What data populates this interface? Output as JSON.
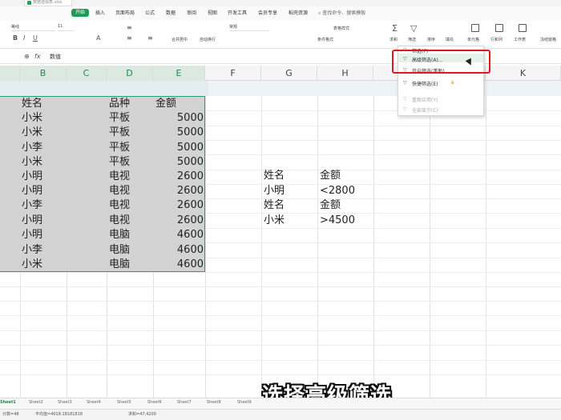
{
  "window": {
    "file_title": "数据透视表.xlsx"
  },
  "menu": {
    "tabs": [
      "开始",
      "插入",
      "页面布局",
      "公式",
      "数据",
      "审阅",
      "视图",
      "开发工具",
      "会员专享",
      "稻壳资源"
    ],
    "search": "查找命令、搜索模板"
  },
  "toolbar": {
    "font_name": "等线",
    "font_size": "11",
    "number_format": "常规",
    "labels": [
      "合并居中",
      "自动换行",
      "条件格式",
      "表格样式",
      "求和",
      "筛选",
      "排序",
      "填充",
      "单元格",
      "行和列",
      "工作表",
      "冻结窗格"
    ]
  },
  "formula_bar": {
    "value": "数值"
  },
  "columns": [
    "B",
    "C",
    "D",
    "E",
    "F",
    "G",
    "H",
    "I",
    "J",
    "K"
  ],
  "table": {
    "headers": {
      "name": "姓名",
      "kind": "品种",
      "amount": "金额"
    },
    "rows": [
      {
        "name": "小米",
        "kind": "平板",
        "amount": "5000"
      },
      {
        "name": "小米",
        "kind": "平板",
        "amount": "5000"
      },
      {
        "name": "小李",
        "kind": "平板",
        "amount": "5000"
      },
      {
        "name": "小米",
        "kind": "平板",
        "amount": "5000"
      },
      {
        "name": "小明",
        "kind": "电视",
        "amount": "2600"
      },
      {
        "name": "小明",
        "kind": "电视",
        "amount": "2600"
      },
      {
        "name": "小李",
        "kind": "电视",
        "amount": "2600"
      },
      {
        "name": "小明",
        "kind": "电视",
        "amount": "2600"
      },
      {
        "name": "小明",
        "kind": "电脑",
        "amount": "4600"
      },
      {
        "name": "小李",
        "kind": "电脑",
        "amount": "4600"
      },
      {
        "name": "小米",
        "kind": "电脑",
        "amount": "4600"
      }
    ]
  },
  "criteria": [
    {
      "g": "姓名",
      "h": "金额"
    },
    {
      "g": "小明",
      "h": "<2800"
    },
    {
      "g": "姓名",
      "h": "金额"
    },
    {
      "g": "小米",
      "h": ">4500"
    }
  ],
  "dropdown": {
    "items": [
      {
        "label": "筛选(F)",
        "enabled": true
      },
      {
        "label": "高级筛选(A)...",
        "enabled": true
      },
      {
        "label": "开启筛选(重新)",
        "enabled": true
      },
      {
        "label": "快捷筛选(E)",
        "enabled": true
      },
      {
        "label": "重新应用(Y)",
        "enabled": false
      },
      {
        "label": "全部显示(C)",
        "enabled": false
      }
    ]
  },
  "sheets": [
    "Sheet1",
    "Sheet2",
    "Sheet3",
    "Sheet4",
    "Sheet5",
    "Sheet6",
    "Sheet7",
    "Sheet8",
    "Sheet9"
  ],
  "status": {
    "count": "计数=48",
    "average": "平均值=4018.18181818",
    "sum": "求和=47,4200"
  },
  "subtitle": "选择高级筛选",
  "colors": {
    "accent": "#1d9b57",
    "highlight_box": "#e0181d",
    "selection_border": "#2f9c6a"
  }
}
